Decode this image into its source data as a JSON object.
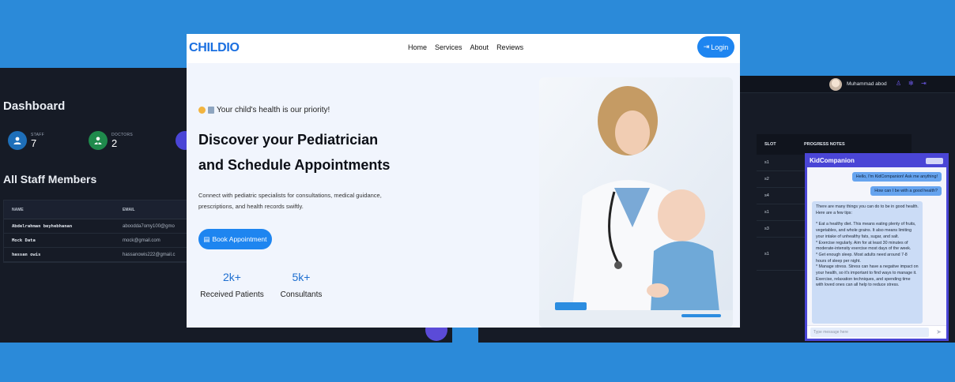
{
  "dashboard": {
    "title": "Dashboard",
    "stats": [
      {
        "label": "STAFF",
        "value": "7"
      },
      {
        "label": "DOCTORS",
        "value": "2"
      }
    ],
    "staff_title": "All Staff Members",
    "columns": [
      "NAME",
      "EMAIL"
    ],
    "rows": [
      {
        "name": "Abdelrahman beyhebhanan",
        "email": "aboodda7omy100@gmo"
      },
      {
        "name": "Mock Data",
        "email": "mock@gmail.com"
      },
      {
        "name": "hassan owis",
        "email": "hassanowis222@gmail.c"
      }
    ]
  },
  "right_dashboard": {
    "user_name": "Muhammad abod",
    "columns": [
      "SLOT",
      "PROGRESS NOTES"
    ],
    "slots": [
      "s1",
      "s2",
      "s4",
      "s1",
      "s3",
      "s1"
    ]
  },
  "chat": {
    "title": "KidCompanion",
    "greeting": "Hello, I'm KidCompanion! Ask me anything!",
    "question": "How can I be with a good health?",
    "answer": [
      "There are many things you can do to be in good health. Here are a few tips:",
      "",
      "* Eat a healthy diet. This means eating plenty of fruits, vegetables, and whole grains. It also means limiting your intake of unhealthy fats, sugar, and salt.",
      "* Exercise regularly. Aim for at least 30 minutes of moderate-intensity exercise most days of the week.",
      "* Get enough sleep. Most adults need around 7-8 hours of sleep per night.",
      "* Manage stress. Stress can have a negative impact on your health, so it's important to find ways to manage it. Exercise, relaxation techniques, and spending time with loved ones can all help to reduce stress."
    ],
    "input_placeholder": "Type message here"
  },
  "landing": {
    "logo": "CHILDIO",
    "nav": [
      "Home",
      "Services",
      "About",
      "Reviews"
    ],
    "login_label": "Login",
    "tagline": "Your child's health is our priority!",
    "headline_line1": "Discover your Pediatrician",
    "headline_line2": "and Schedule Appointments",
    "description": "Connect with pediatric specialists for consultations, medical guidance, prescriptions, and health records swiftly.",
    "cta_label": "Book Appointment",
    "stats": [
      {
        "value": "2k+",
        "label": "Received Patients"
      },
      {
        "value": "5k+",
        "label": "Consultants"
      }
    ]
  },
  "colors": {
    "background": "#2b8ad9",
    "brand": "#1e85f0",
    "dark_panel": "#161b26",
    "chat_accent": "#4a45d6"
  }
}
